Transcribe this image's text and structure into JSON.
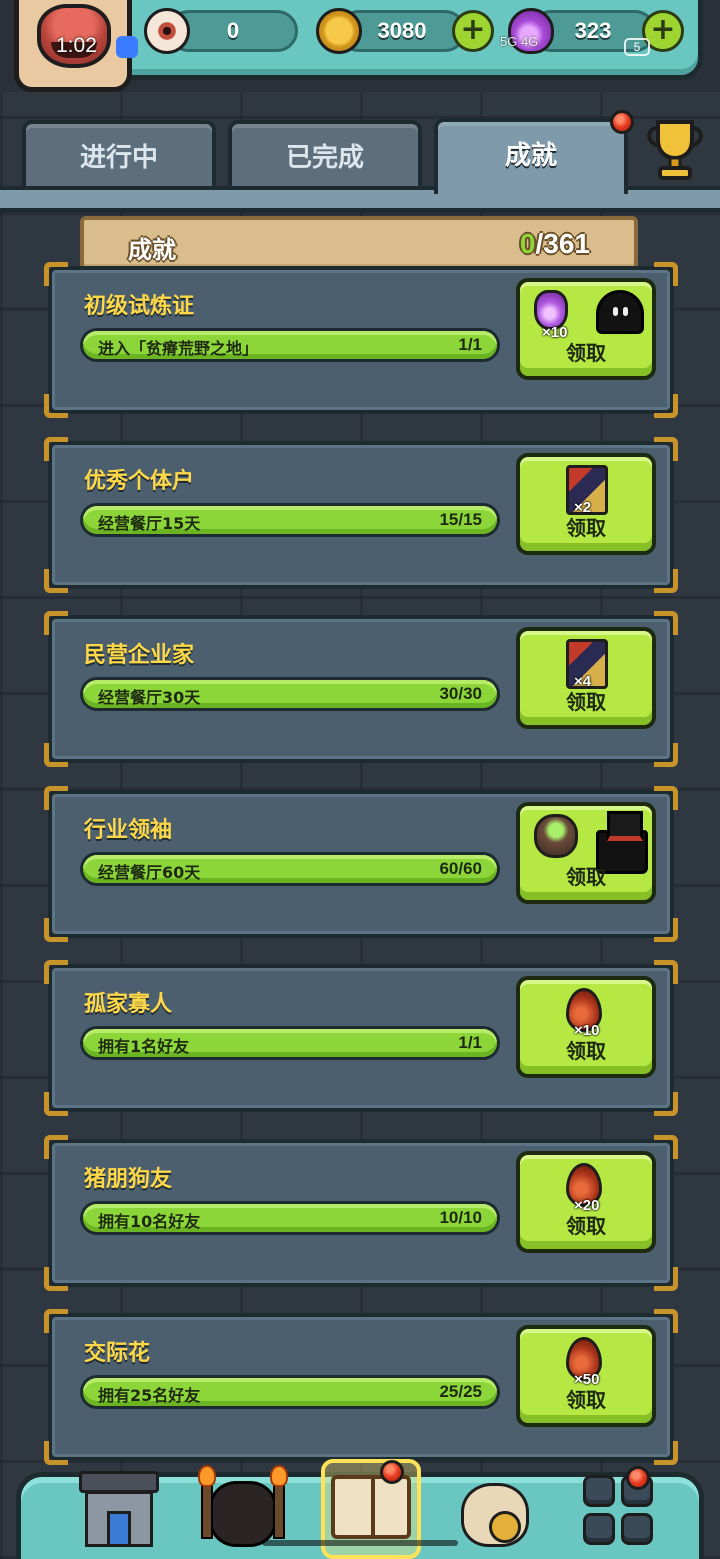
{
  "status_bar": {
    "time": "1:02",
    "network": "5G  4G",
    "battery": "5"
  },
  "resources": {
    "eyes": "0",
    "coins": "3080",
    "potions": "323"
  },
  "tabs": [
    {
      "label": "进行中",
      "active": false
    },
    {
      "label": "已完成",
      "active": false
    },
    {
      "label": "成就",
      "active": true
    }
  ],
  "header": {
    "title": "成就",
    "done": "0",
    "total": "/361"
  },
  "claim_label": "领取",
  "achievements": [
    {
      "title": "初级试炼证",
      "task": "进入「贫瘠荒野之地」",
      "progress": "1/1",
      "fill": 1.0,
      "rewards": [
        {
          "icon": "purple-potion-icon",
          "mult": "×10"
        },
        {
          "icon": "black-ghost-icon",
          "mult": ""
        }
      ]
    },
    {
      "title": "优秀个体户",
      "task": "经营餐厅15天",
      "progress": "15/15",
      "fill": 1.0,
      "rewards": [
        {
          "icon": "card-pack-icon",
          "mult": "×2"
        }
      ]
    },
    {
      "title": "民营企业家",
      "task": "经营餐厅30天",
      "progress": "30/30",
      "fill": 1.0,
      "rewards": [
        {
          "icon": "card-pack-icon",
          "mult": "×4"
        }
      ]
    },
    {
      "title": "行业领袖",
      "task": "经营餐厅60天",
      "progress": "60/60",
      "fill": 1.0,
      "rewards": [
        {
          "icon": "green-ore-rock-icon",
          "mult": ""
        },
        {
          "icon": "top-hat-ghost-icon",
          "mult": ""
        }
      ]
    },
    {
      "title": "孤家寡人",
      "task": "拥有1名好友",
      "progress": "1/1",
      "fill": 1.0,
      "rewards": [
        {
          "icon": "red-drop-icon",
          "mult": "×10"
        }
      ]
    },
    {
      "title": "猪朋狗友",
      "task": "拥有10名好友",
      "progress": "10/10",
      "fill": 1.0,
      "rewards": [
        {
          "icon": "red-drop-icon",
          "mult": "×20"
        }
      ]
    },
    {
      "title": "交际花",
      "task": "拥有25名好友",
      "progress": "25/25",
      "fill": 1.0,
      "rewards": [
        {
          "icon": "red-drop-icon",
          "mult": "×50"
        }
      ]
    }
  ],
  "bottom_nav": [
    {
      "icon": "restaurant-shop-icon"
    },
    {
      "icon": "monster-gate-icon"
    },
    {
      "icon": "quest-book-icon",
      "active": true,
      "badge": true
    },
    {
      "icon": "money-bag-icon"
    },
    {
      "icon": "grid-menu-icon",
      "badge": true
    }
  ],
  "colors": {
    "accent_green": "#b5e843",
    "progress_green": "#8dd63a",
    "title_yellow": "#ffd84a",
    "teal_bar": "#6ac6c0"
  }
}
